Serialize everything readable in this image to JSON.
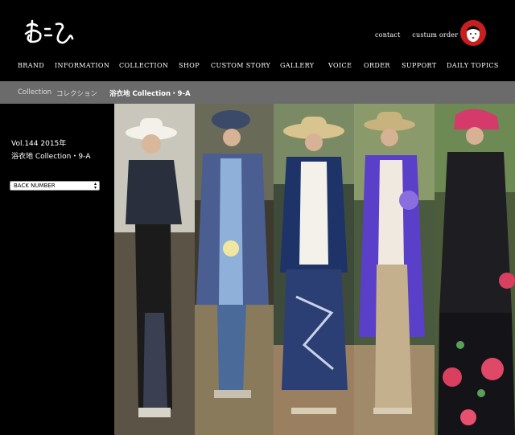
{
  "header": {
    "top_links": [
      "contact",
      "custum order"
    ]
  },
  "nav": {
    "items": [
      "BRAND",
      "INFORMATION",
      "COLLECTION",
      "SHOP",
      "CUSTOM STORY",
      "GALLERY",
      "VOICE",
      "ORDER",
      "SUPPORT",
      "DAILY TOPICS"
    ]
  },
  "breadcrumb": {
    "items": [
      "Collection",
      "コレクション",
      "浴衣地 Collection・9-A"
    ]
  },
  "sidebar": {
    "volume": "Vol.144 2015年",
    "title": "浴衣地 Collection・9-A",
    "select_value": "BACK NUMBER"
  },
  "colors": {
    "background": "#000000",
    "breadcrumb_bar": "#6b6b6b",
    "badge": "#c81e1e"
  }
}
